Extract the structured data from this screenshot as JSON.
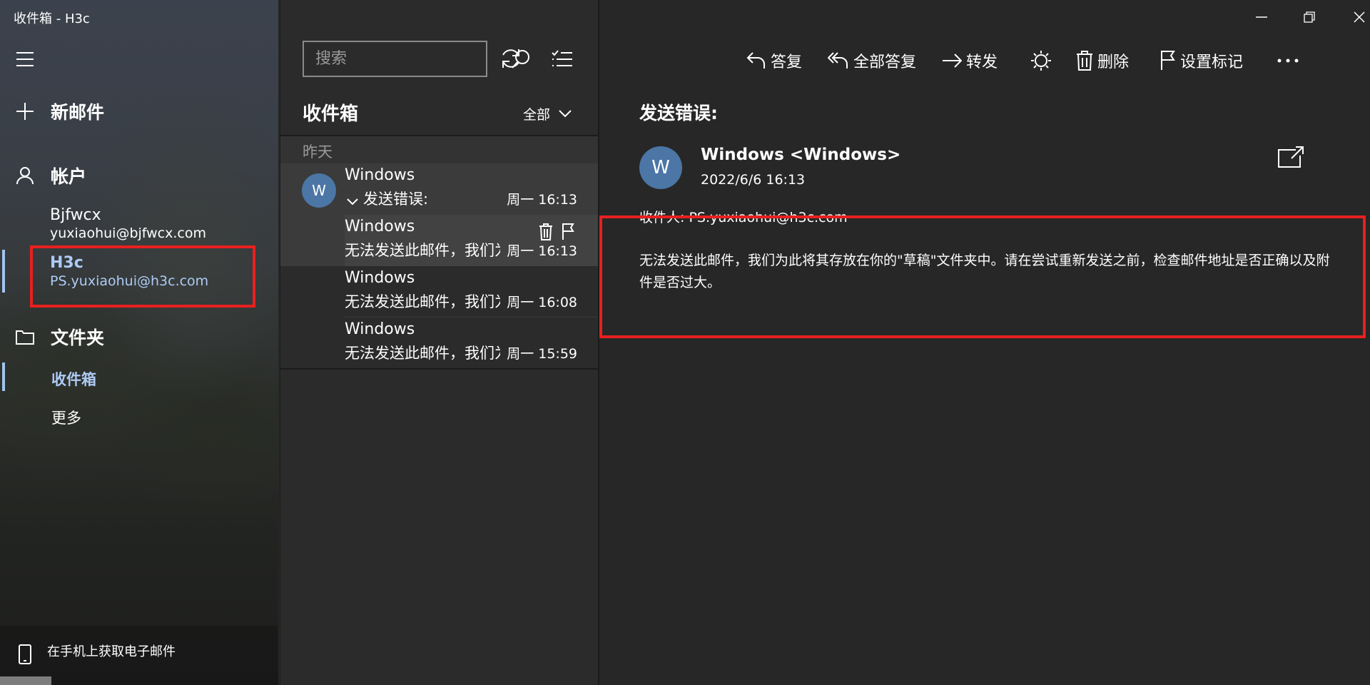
{
  "app": {
    "title": "收件箱 - H3c"
  },
  "nav": {
    "new_mail": "新邮件",
    "accounts_header": "帐户",
    "accounts": [
      {
        "name": "Bjfwcx",
        "email": "yuxiaohui@bjfwcx.com"
      },
      {
        "name": "H3c",
        "email": "PS.yuxiaohui@h3c.com"
      }
    ],
    "folders_header": "文件夹",
    "folders": [
      {
        "label": "收件箱"
      },
      {
        "label": "更多"
      }
    ],
    "mobile_promo": "在手机上获取电子邮件"
  },
  "list": {
    "search_placeholder": "搜索",
    "title": "收件箱",
    "filter": "全部",
    "group_header": "昨天",
    "avatar_letter": "W",
    "messages": [
      {
        "sender": "Windows",
        "subject": "发送错误:",
        "time": "周一 16:13"
      },
      {
        "sender": "Windows",
        "subject": "无法发送此邮件，我们为此将其存放在你的",
        "time": "周一 16:13"
      },
      {
        "sender": "Windows",
        "subject": "无法发送此邮件，我们为此将其存放在你的",
        "time": "周一 16:08"
      },
      {
        "sender": "Windows",
        "subject": "无法发送此邮件，我们为此将其存放在你的",
        "time": "周一 15:59"
      }
    ]
  },
  "toolbar": {
    "reply": "答复",
    "reply_all": "全部答复",
    "forward": "转发",
    "delete": "删除",
    "flag": "设置标记"
  },
  "reading": {
    "subject": "发送错误:",
    "avatar_letter": "W",
    "from": "Windows <Windows>",
    "date": "2022/6/6 16:13",
    "to": "收件人: PS.yuxiaohui@h3c.com",
    "body": "无法发送此邮件，我们为此将其存放在你的\"草稿\"文件夹中。请在尝试重新发送之前，检查邮件地址是否正确以及附件是否过大。"
  },
  "colors": {
    "accent": "#aecbf5",
    "avatar": "#4b76a6",
    "annotation": "#e8201f",
    "pane_bg": "#272727"
  },
  "icons": [
    "hamburger-icon",
    "plus-icon",
    "person-icon",
    "folder-icon",
    "phone-icon",
    "search-icon",
    "sync-icon",
    "select-icon",
    "chevron-down-icon",
    "trash-icon",
    "flag-icon",
    "reply-icon",
    "reply-all-icon",
    "forward-icon",
    "sun-icon",
    "more-icon",
    "popout-icon",
    "minimize-icon",
    "maximize-icon",
    "close-icon"
  ]
}
